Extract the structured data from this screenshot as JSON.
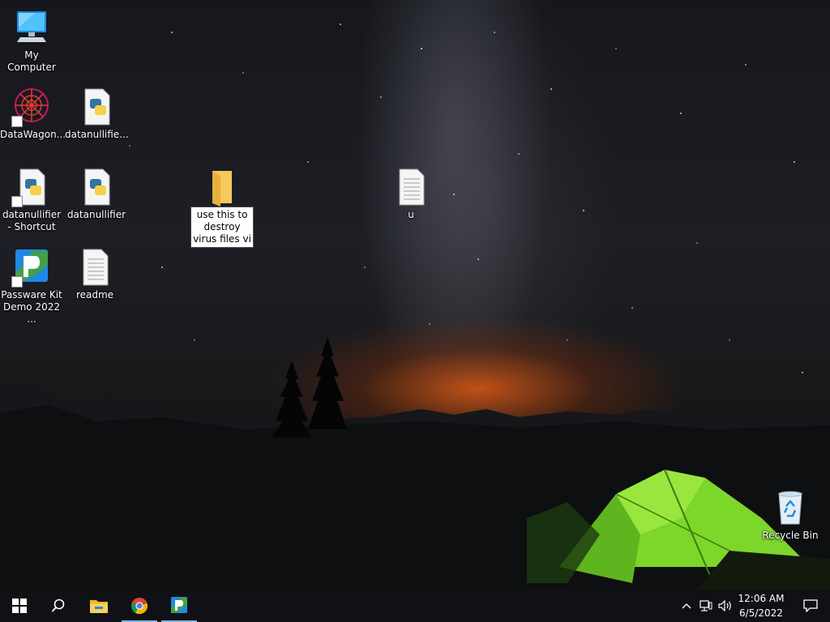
{
  "desktop": {
    "icons": [
      {
        "label": "My Computer"
      },
      {
        "label": "DataWagon..."
      },
      {
        "label": "datanullifie..."
      },
      {
        "label": "datanullifier - Shortcut"
      },
      {
        "label": "datanullifier"
      },
      {
        "label": "Passware Kit Demo 2022 ..."
      },
      {
        "label": "readme"
      },
      {
        "label": "u"
      },
      {
        "label": "Recycle Bin"
      }
    ],
    "rename_folder": {
      "value": "use this to destroy virus files vi"
    }
  },
  "taskbar": {
    "apps": [
      "start-icon",
      "search-icon",
      "file-explorer-icon",
      "chrome-icon",
      "passware-icon"
    ],
    "tray_icons": [
      "chevron-up-icon",
      "network-icon",
      "volume-icon"
    ],
    "time": "12:06 AM",
    "date": "6/5/2022",
    "notification_icon": "action-center-icon"
  },
  "colors": {
    "taskbar": "#101114",
    "active_indicator": "#76b9ed",
    "tent": "#7dd62a"
  }
}
